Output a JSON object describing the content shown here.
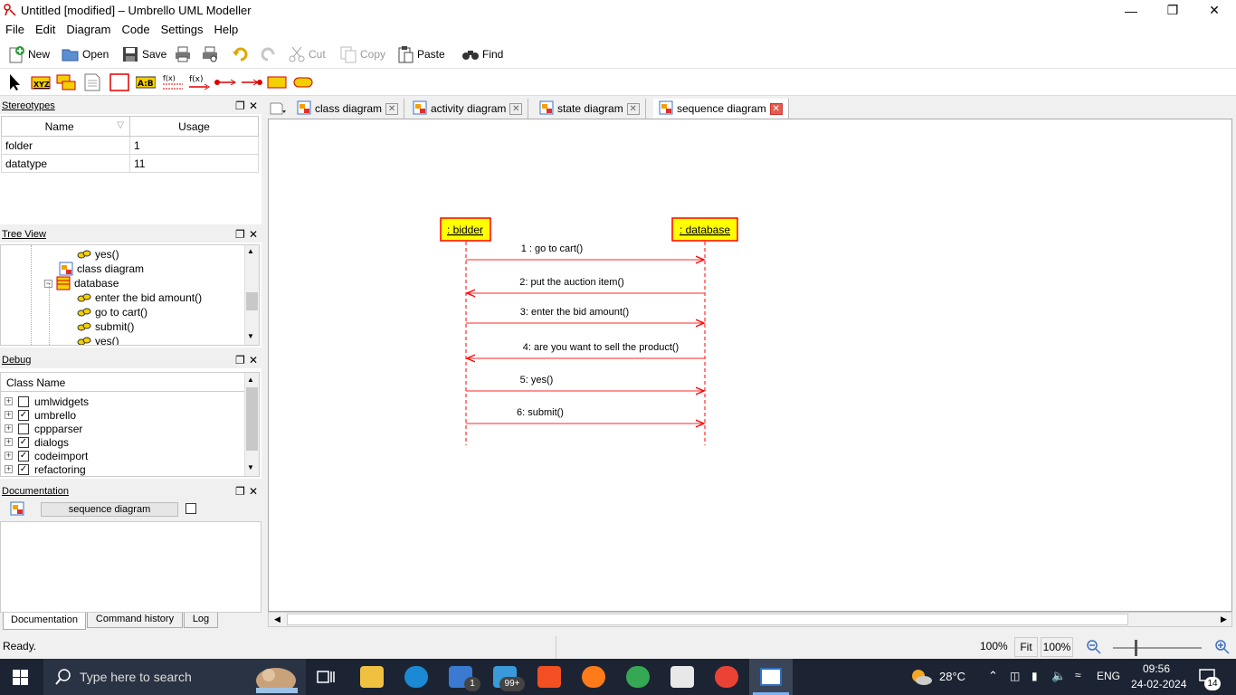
{
  "window": {
    "title": "Untitled [modified] – Umbrello UML Modeller"
  },
  "menu": [
    "File",
    "Edit",
    "Diagram",
    "Code",
    "Settings",
    "Help"
  ],
  "toolbar": {
    "new": "New",
    "open": "Open",
    "save": "Save",
    "cut": "Cut",
    "copy": "Copy",
    "paste": "Paste",
    "find": "Find"
  },
  "drawbar": {
    "xyz": "XYZ",
    "ab": "A:B",
    "fx1": "f(x)",
    "fx2": "f(x)"
  },
  "stereotypes": {
    "title": "Stereotypes",
    "columns": [
      "Name",
      "Usage"
    ],
    "rows": [
      {
        "name": "folder",
        "usage": "1"
      },
      {
        "name": "datatype",
        "usage": "11"
      }
    ]
  },
  "treeview": {
    "title": "Tree View",
    "items": [
      "yes()",
      "class diagram",
      "database",
      "enter the bid amount()",
      "go to cart()",
      "submit()",
      "yes()"
    ]
  },
  "debug": {
    "title": "Debug",
    "column": "Class Name",
    "rows": [
      {
        "name": "umlwidgets",
        "checked": false
      },
      {
        "name": "umbrello",
        "checked": true
      },
      {
        "name": "cppparser",
        "checked": false
      },
      {
        "name": "dialogs",
        "checked": true
      },
      {
        "name": "codeimport",
        "checked": true
      },
      {
        "name": "refactoring",
        "checked": true
      }
    ]
  },
  "documentation": {
    "title": "Documentation",
    "field": "sequence diagram",
    "tabs": [
      "Documentation",
      "Command history",
      "Log"
    ]
  },
  "tabs": [
    "class diagram",
    "activity diagram",
    "state diagram",
    "sequence diagram"
  ],
  "diagram": {
    "objects": [
      ": bidder",
      ": database"
    ],
    "messages": [
      "1 : go to cart()",
      "2: put the auction item()",
      "3: enter the bid amount()",
      "4: are you want to sell the product()",
      "5: yes()",
      "6: submit()"
    ],
    "colors": {
      "object_fill": "#ffff00",
      "object_border": "#ff0000",
      "line": "#ff0000"
    }
  },
  "status": {
    "text": "Ready.",
    "zoom1": "100%",
    "fit": "Fit",
    "zoom2": "100%"
  },
  "taskbar": {
    "search": "Type here to search",
    "mail_badge": "1",
    "chat_badge": "99+",
    "weather": "28°C",
    "lang": "ENG",
    "time": "09:56",
    "date": "24-02-2024",
    "notif": "14"
  }
}
